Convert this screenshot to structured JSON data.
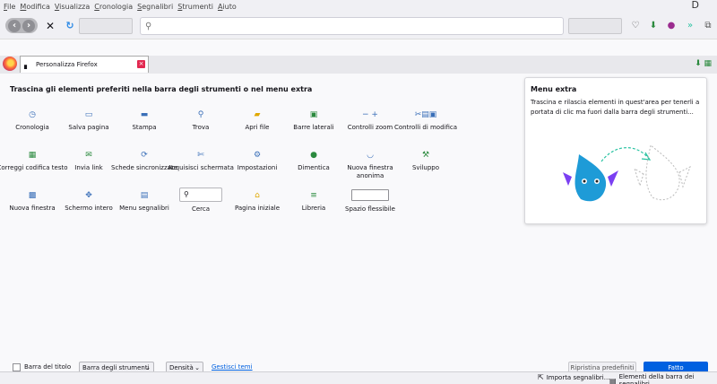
{
  "menu": [
    "File",
    "Modifica",
    "Visualizza",
    "Cronologia",
    "Segnalibri",
    "Strumenti",
    "Aiuto"
  ],
  "menu_accel": [
    "F",
    "M",
    "V",
    "C",
    "S",
    "S",
    "A"
  ],
  "window_corner": "D",
  "tab": {
    "title": "Personalizza Firefox"
  },
  "main": {
    "drag_title": "Trascina gli elementi preferiti nella barra degli strumenti o nel menu extra"
  },
  "palette": [
    {
      "label": "Cronologia",
      "icon": "history-icon",
      "glyph": "◷"
    },
    {
      "label": "Salva pagina",
      "icon": "save-page-icon",
      "glyph": "▭"
    },
    {
      "label": "Stampa",
      "icon": "print-icon",
      "glyph": "▬"
    },
    {
      "label": "Trova",
      "icon": "find-icon",
      "glyph": "⚲"
    },
    {
      "label": "Apri file",
      "icon": "open-file-icon",
      "glyph": "▰"
    },
    {
      "label": "Barre laterali",
      "icon": "sidebar-icon",
      "glyph": "▣"
    },
    {
      "label": "Controlli zoom",
      "icon": "zoom-controls-icon",
      "glyph": "− +"
    },
    {
      "label": "Controlli di modifica",
      "icon": "edit-controls-icon",
      "glyph": "✂▤▣"
    },
    {
      "label": "Correggi codifica testo",
      "icon": "text-encoding-icon",
      "glyph": "▦"
    },
    {
      "label": "Invia link",
      "icon": "email-link-icon",
      "glyph": "✉"
    },
    {
      "label": "Schede sincronizzate",
      "icon": "synced-tabs-icon",
      "glyph": "⟳"
    },
    {
      "label": "Acquisisci schermata",
      "icon": "screenshot-icon",
      "glyph": "✄"
    },
    {
      "label": "Impostazioni",
      "icon": "settings-icon",
      "glyph": "⚙"
    },
    {
      "label": "Dimentica",
      "icon": "forget-icon",
      "glyph": "●"
    },
    {
      "label": "Nuova finestra anonima",
      "icon": "private-window-icon",
      "glyph": "◡"
    },
    {
      "label": "Sviluppo",
      "icon": "developer-icon",
      "glyph": "⚒"
    },
    {
      "label": "Nuova finestra",
      "icon": "new-window-icon",
      "glyph": "▩"
    },
    {
      "label": "Schermo intero",
      "icon": "fullscreen-icon",
      "glyph": "✥"
    },
    {
      "label": "Menu segnalibri",
      "icon": "bookmarks-menu-icon",
      "glyph": "▤"
    },
    {
      "label": "Cerca",
      "icon": "search-icon",
      "glyph": "⚲"
    },
    {
      "label": "Pagina iniziale",
      "icon": "home-icon",
      "glyph": "⌂"
    },
    {
      "label": "Libreria",
      "icon": "library-icon",
      "glyph": "≡"
    },
    {
      "label": "Spazio flessibile",
      "icon": "flexible-space-icon",
      "glyph": ""
    }
  ],
  "overflow": {
    "title": "Menu extra",
    "description": "Trascina e rilascia elementi in quest'area per tenerli a portata di clic ma fuori dalla barra degli strumenti..."
  },
  "bottom": {
    "title_bar_label": "Barra del titolo",
    "toolbars_select": "Barra degli strumenti",
    "density_select": "Densità",
    "manage_themes": "Gestisci temi",
    "restore_defaults": "Ripristina predefiniti",
    "done": "Fatto"
  },
  "bookmarks_bar": {
    "import": "Importa segnalibri...",
    "other": "Elementi della barra dei segnalibri"
  },
  "colors": {
    "accent": "#0061e0",
    "tab_close": "#e22850",
    "sync_blue": "#2f8be6",
    "green": "#2ac3a2"
  }
}
